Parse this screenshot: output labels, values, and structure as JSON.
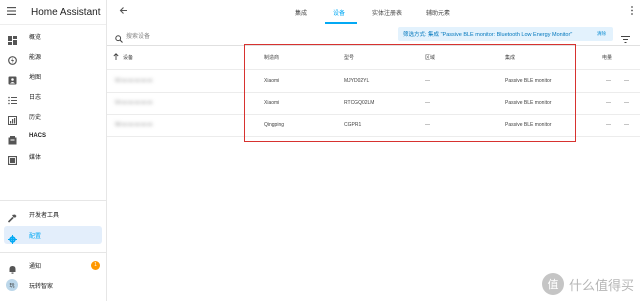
{
  "app": {
    "title": "Home Assistant"
  },
  "sidebar": {
    "items": [
      {
        "label": "概览",
        "icon": "dashboard-icon"
      },
      {
        "label": "能源",
        "icon": "energy-icon"
      },
      {
        "label": "地图",
        "icon": "map-icon"
      },
      {
        "label": "日志",
        "icon": "logbook-icon"
      },
      {
        "label": "历史",
        "icon": "history-icon"
      },
      {
        "label": "HACS",
        "icon": "hacs-icon"
      },
      {
        "label": "媒体",
        "icon": "media-icon"
      }
    ],
    "dev_tools": "开发者工具",
    "config": "配置",
    "notifications": "通知",
    "notification_count": "1",
    "user_name": "玩转智家",
    "user_initials": "玩"
  },
  "tabs": [
    "集成",
    "设备",
    "实体注册表",
    "辅助元素"
  ],
  "active_tab": "设备",
  "search": {
    "placeholder": "搜索设备"
  },
  "filter": {
    "text": "筛选方式: 集成 \"Passive BLE monitor: Bluetooth Low Energy Monitor\"",
    "clear": "清除"
  },
  "table": {
    "headers": {
      "device": "设备",
      "manufacturer": "制造商",
      "model": "型号",
      "area": "区域",
      "integration": "集成",
      "battery": "电量"
    },
    "rows": [
      {
        "name": "50:xx:xx:xx:xx:xx",
        "manufacturer": "Xiaomi",
        "model": "MJYD02YL",
        "area": "—",
        "integration": "Passive BLE monitor",
        "battery": "—"
      },
      {
        "name": "54:xx:xx:xx:xx:xx",
        "manufacturer": "Xiaomi",
        "model": "RTCGQ02LM",
        "area": "—",
        "integration": "Passive BLE monitor",
        "battery": "—"
      },
      {
        "name": "58:xx:xx:xx:xx:xx",
        "manufacturer": "Qingping",
        "model": "CGPR1",
        "area": "—",
        "integration": "Passive BLE monitor",
        "battery": "—"
      }
    ]
  },
  "watermark": {
    "mark": "值",
    "text": "什么值得买"
  },
  "colors": {
    "accent": "#03a9f4",
    "highlight_border": "#d7322f",
    "badge": "#ff9800"
  }
}
